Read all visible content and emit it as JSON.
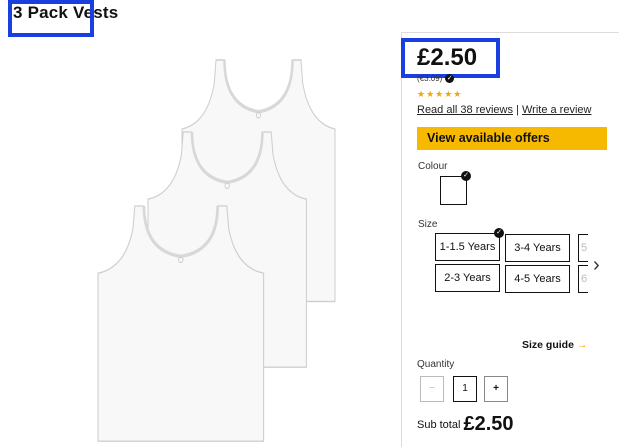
{
  "product": {
    "title": "3 Pack Vests",
    "price": "£2.50",
    "euro_price": "(€3.09)",
    "rating": 4.5,
    "stars_text": "★★★★★",
    "reviews_link": "Read all 38 reviews",
    "reviews_sep": " | ",
    "write_review": "Write a review",
    "offers_button": "View available offers"
  },
  "colour": {
    "label": "Colour"
  },
  "size": {
    "label": "Size",
    "options": [
      "1-1.5 Years",
      "3-4 Years",
      "5",
      "2-3 Years",
      "4-5 Years",
      "6"
    ],
    "selected": "1-1.5 Years",
    "guide": "Size guide",
    "guide_arrow": "→"
  },
  "quantity": {
    "label": "Quantity",
    "minus": "−",
    "value": "1",
    "plus": "+"
  },
  "subtotal": {
    "label": "Sub total",
    "value": "£2.50"
  },
  "colors": {
    "accent": "#f7b800",
    "highlight": "#1a3fe0"
  },
  "icons": [
    "info-icon",
    "checkmark-icon",
    "chevron-right-icon",
    "arrow-right-icon"
  ]
}
